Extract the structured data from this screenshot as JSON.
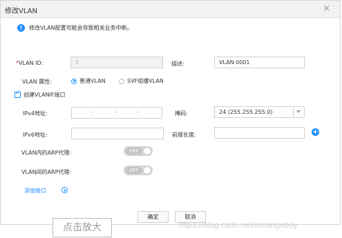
{
  "dialog": {
    "title": "修改VLAN",
    "close": "×",
    "warning": "修改VLAN配置可能会导致相关业务中断。"
  },
  "form": {
    "vlan_id_required": "*",
    "vlan_id_label": "VLAN ID:",
    "vlan_id_value": "1",
    "desc_label": "描述:",
    "desc_value": "VLAN 0001",
    "attr_label": "VLAN 属性:",
    "attr_options": [
      "普通VLAN",
      "SVF组播VLAN"
    ],
    "attr_selected": "普通VLAN",
    "create_vlanif_label": "创建VLANIF接口",
    "create_vlanif_checked": true,
    "ipv4_label": "IPv4地址:",
    "ipv4_sep": ".",
    "mask_label": "掩码:",
    "mask_value": "24 (255.255.255.0)",
    "ipv6_label": "IPv6地址:",
    "ipv6_value": "",
    "prefix_label": "前缀长度:",
    "prefix_value": "",
    "arp_in_label": "VLAN内的ARP代理:",
    "arp_in_state": "OFF",
    "arp_between_label": "VLAN间的ARP代理:",
    "arp_between_state": "OFF",
    "add_interface_label": "添加接口"
  },
  "buttons": {
    "ok": "确定",
    "cancel": "取消"
  },
  "overlay": {
    "zoom_text": "点击放大",
    "watermark": "https://blog.csdn.net/istrangeboy"
  },
  "colors": {
    "accent": "#1e90ff",
    "required": "#ee3333"
  }
}
